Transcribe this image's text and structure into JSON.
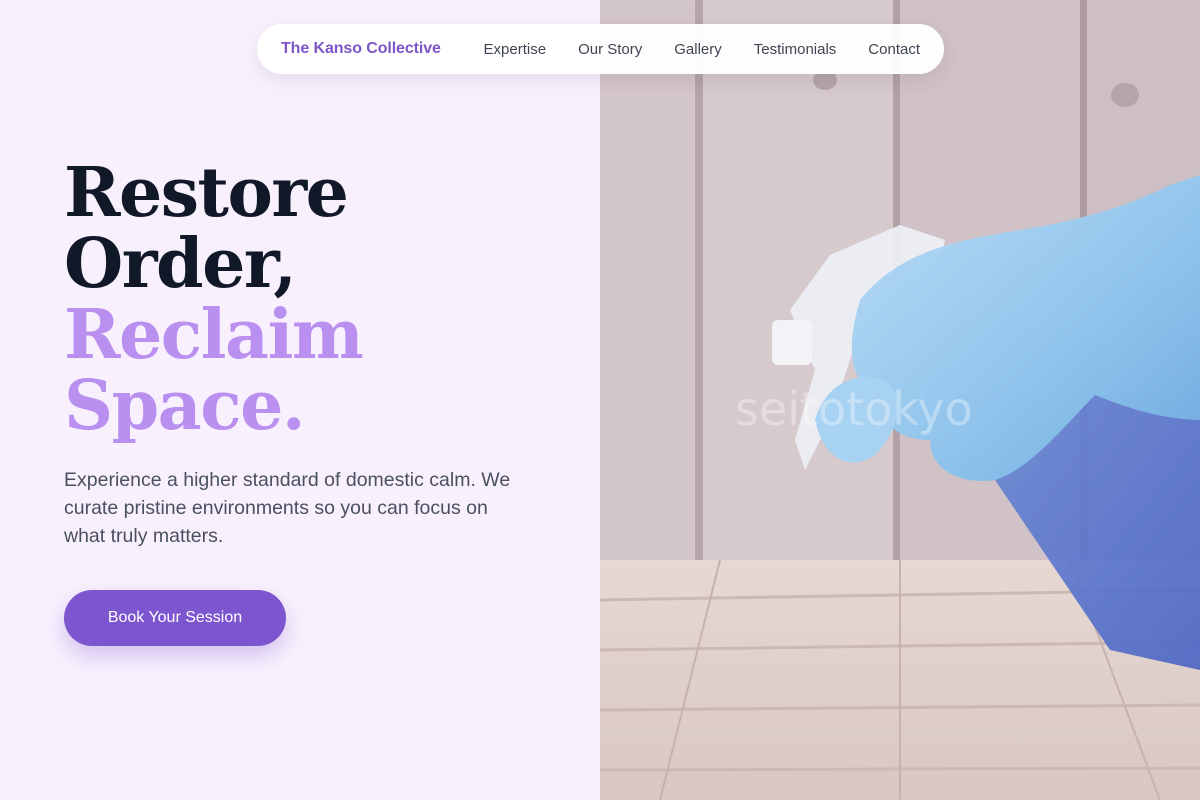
{
  "nav": {
    "brand": "The Kanso Collective",
    "links": [
      "Expertise",
      "Our Story",
      "Gallery",
      "Testimonials",
      "Contact"
    ]
  },
  "hero": {
    "headline": {
      "line1": "Restore",
      "line2": "Order,",
      "line3": "Reclaim",
      "line4": "Space."
    },
    "subtext": "Experience a higher standard of domestic calm. We curate pristine environments so you can focus on what truly matters.",
    "cta_label": "Book Your Session",
    "image": {
      "subject": "gloved hand holding spray bottle over wooden surface",
      "watermark": "seitotokyo"
    }
  },
  "colors": {
    "brand": "#7d55c7",
    "accent_headline": "#b98ff0",
    "cta": "#7d55cf",
    "page_bg": "#f8f1fd",
    "headline_dark": "#111827"
  }
}
